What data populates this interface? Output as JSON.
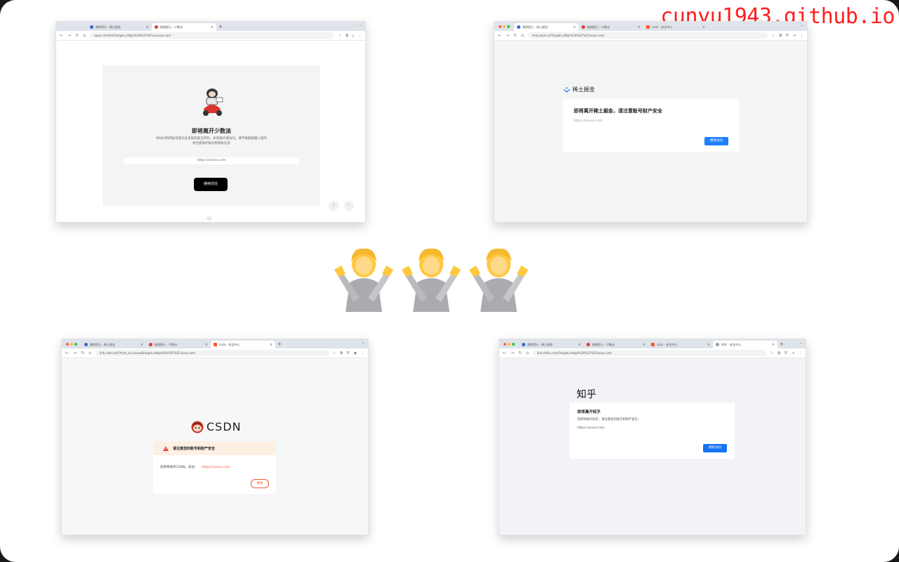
{
  "watermark": "cunyu1943.github.io",
  "colors": {
    "watermark": "#ff1f1f",
    "juejin_blue": "#1e80ff",
    "csdn_orange": "#fc5531",
    "zhihu_blue": "#1772f6",
    "sspai_black": "#000000"
  },
  "sspai": {
    "tabs": [
      {
        "label": "跳转提示 - 稀土掘金",
        "active": false
      },
      {
        "label": "链接提示 - 少数派",
        "active": true
      }
    ],
    "url": "sspai.com/link?target=https%3A%2F%2Fxxxxxxx.com",
    "title": "即将离开少数派",
    "description_line1": "你访问的网站可能包含未知的安全风险，如有疑问请访问。请不要随意输入您的",
    "description_line2": "并注意保护账号和隐私信息",
    "target_url": "https://xxxxx.com",
    "continue_label": "继续前往"
  },
  "juejin": {
    "tabs": [
      {
        "label": "跳转提示 - 稀土掘金",
        "active": true
      },
      {
        "label": "链接提示 - 少数派",
        "active": false
      },
      {
        "label": "csdn - 安全中心",
        "active": false
      }
    ],
    "url": "link.juejin.cn/?target=https%3A%2F%2Fxxxxx.com",
    "brand": "稀土掘金",
    "title": "即将离开稀土掘金，请注意账号财产安全",
    "target_url": "https://xxxxx.com",
    "continue_label": "继续访问"
  },
  "csdn": {
    "tabs": [
      {
        "label": "跳转提示 - 稀土掘金",
        "active": false
      },
      {
        "label": "链接提示 - 少数派",
        "active": false
      },
      {
        "label": "csdn - 安全中心",
        "active": true
      }
    ],
    "url": "link.csdn.net/?from_id=xxxxx&target=https%3A%2F%2Fxxxxx.com",
    "brand": "CSDN",
    "warning": "请注意您的账号和财产安全",
    "notice": "您即将离开CSDN，去往：",
    "target_url": "https://xxxxx.com",
    "continue_label": "继续"
  },
  "zhihu": {
    "tabs": [
      {
        "label": "跳转提示 - 稀土掘金",
        "active": false
      },
      {
        "label": "链接提示 - 少数派",
        "active": false
      },
      {
        "label": "csdn - 安全中心",
        "active": false
      },
      {
        "label": "知乎 - 安全中心",
        "active": true
      }
    ],
    "url": "link.zhihu.com/?target=https%3A%2F%2Fxxxxx.com",
    "brand": "知乎",
    "title": "即将离开知乎",
    "description": "您即将离开知乎，请注意您的账号和财产安全。",
    "target_url": "https://xxxxx.com",
    "continue_label": "继续访问"
  },
  "center_emoji": {
    "icon": "person-gesturing-no",
    "count": 3
  }
}
